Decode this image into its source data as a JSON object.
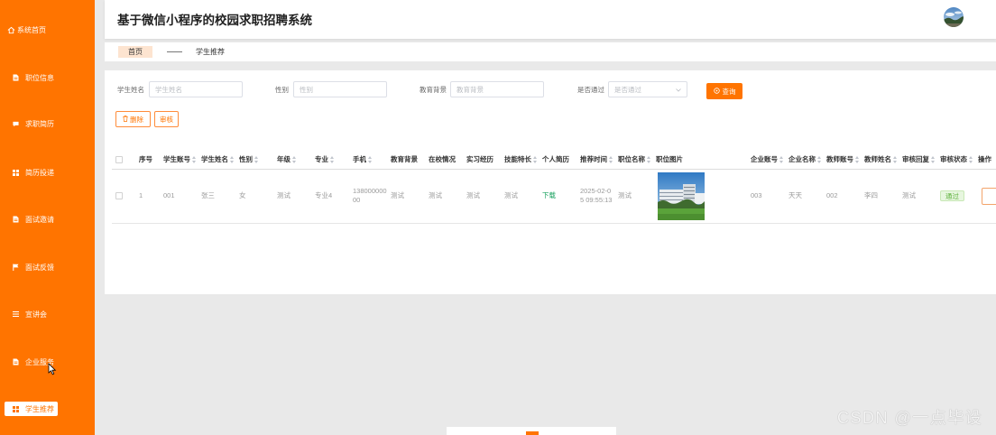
{
  "app": {
    "title": "基于微信小程序的校园求职招聘系统"
  },
  "sidebar": {
    "items": [
      {
        "label": "系统首页",
        "icon": "home-icon"
      },
      {
        "label": "职位信息",
        "icon": "document-icon"
      },
      {
        "label": "求职简历",
        "icon": "comment-icon"
      },
      {
        "label": "简历投递",
        "icon": "grid-icon"
      },
      {
        "label": "面试邀请",
        "icon": "document-icon"
      },
      {
        "label": "面试反馈",
        "icon": "flag-icon"
      },
      {
        "label": "宣讲会",
        "icon": "menu-icon"
      },
      {
        "label": "企业服务",
        "icon": "document-icon"
      },
      {
        "label": "学生推荐",
        "icon": "grid-icon",
        "active": true
      }
    ]
  },
  "tabs": [
    {
      "label": "首页",
      "active": true
    },
    {
      "label": "学生推荐",
      "active": false
    }
  ],
  "search": {
    "fields": [
      {
        "label": "学生姓名",
        "placeholder": "学生姓名"
      },
      {
        "label": "性别",
        "placeholder": "性别"
      },
      {
        "label": "教育背景",
        "placeholder": "教育背景"
      },
      {
        "label": "是否通过",
        "placeholder": "是否通过"
      }
    ],
    "submit_label": "查询"
  },
  "actions": {
    "delete_label": "删除",
    "review_label": "审核"
  },
  "table": {
    "columns": [
      {
        "label": "序号",
        "sortable": false
      },
      {
        "label": "学生账号",
        "sortable": true
      },
      {
        "label": "学生姓名",
        "sortable": true
      },
      {
        "label": "性别",
        "sortable": true
      },
      {
        "label": "年级",
        "sortable": true
      },
      {
        "label": "专业",
        "sortable": true
      },
      {
        "label": "手机",
        "sortable": true
      },
      {
        "label": "教育背景",
        "sortable": false
      },
      {
        "label": "在校情况",
        "sortable": false
      },
      {
        "label": "实习经历",
        "sortable": false
      },
      {
        "label": "技能特长",
        "sortable": true
      },
      {
        "label": "个人简历",
        "sortable": false
      },
      {
        "label": "推荐时间",
        "sortable": true
      },
      {
        "label": "职位名称",
        "sortable": true
      },
      {
        "label": "职位图片",
        "sortable": false
      },
      {
        "label": "企业账号",
        "sortable": true
      },
      {
        "label": "企业名称",
        "sortable": true
      },
      {
        "label": "教师账号",
        "sortable": true
      },
      {
        "label": "教师姓名",
        "sortable": true
      },
      {
        "label": "审核回复",
        "sortable": true
      },
      {
        "label": "审核状态",
        "sortable": true
      },
      {
        "label": "操作",
        "sortable": false
      }
    ],
    "rows": [
      {
        "index": "1",
        "student_account": "001",
        "student_name": "张三",
        "gender": "女",
        "grade": "测试",
        "major": "专业4",
        "phone": "13800000000",
        "education": "测试",
        "school_status": "测试",
        "internship": "测试",
        "skills": "测试",
        "resume_link": "下载",
        "recommend_time": "2025-02-05 09:55:13",
        "position_name": "测试",
        "company_account": "003",
        "company_name": "天天",
        "teacher_account": "002",
        "teacher_name": "李四",
        "review_reply": "测试",
        "review_status": "通过"
      }
    ]
  },
  "watermark": "CSDN @一点毕设",
  "colors": {
    "accent": "#ff7400",
    "active_tab_bg": "#fde4d0",
    "success": "#5cb03a",
    "page_bg": "#e9e9e9"
  }
}
